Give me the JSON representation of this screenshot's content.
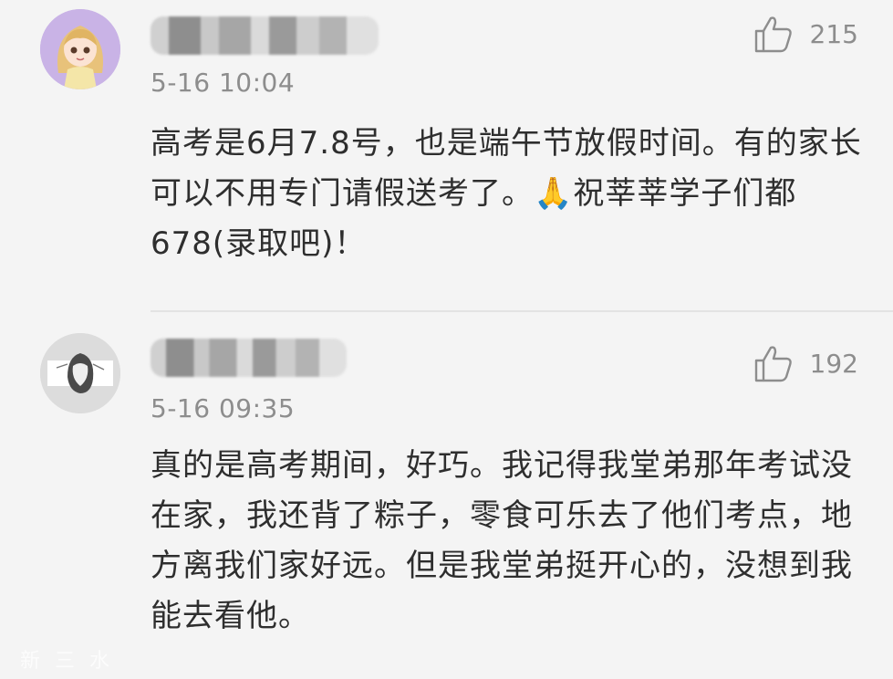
{
  "comments": [
    {
      "timestamp": "5-16 10:04",
      "likes": "215",
      "text": "高考是6月7.8号，也是端午节放假时间。有的家长可以不用专门请假送考了。🙏祝莘莘学子们都678(录取吧)！",
      "avatar_icon": "cartoon-girl-avatar",
      "username_redacted": true
    },
    {
      "timestamp": "5-16 09:35",
      "likes": "192",
      "text": "真的是高考期间，好巧。我记得我堂弟那年考试没在家，我还背了粽子，零食可乐去了他们考点，地方离我们家好远。但是我堂弟挺开心的，没想到我能去看他。",
      "avatar_icon": "sketch-portrait-avatar",
      "username_redacted": true
    }
  ],
  "like_icon": "thumbs-up-icon",
  "watermark": "新三水",
  "colors": {
    "background": "#f4f4f4",
    "meta_text": "#8d8d8d",
    "body_text": "#2e2e2e",
    "divider": "#e3e3e3"
  }
}
